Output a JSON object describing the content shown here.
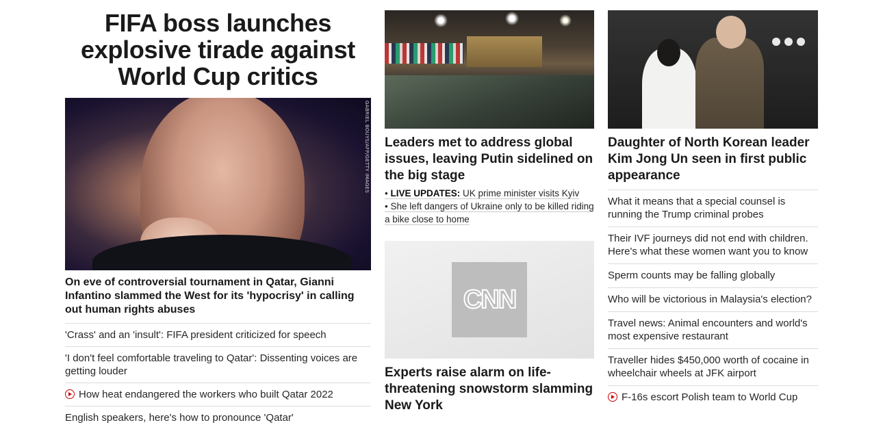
{
  "left": {
    "headline": "FIFA boss launches explosive tirade against World Cup critics",
    "image_credit": "GABRIEL BOUYS/AFP/GETTY IMAGES",
    "lead": "On eve of controversial tournament in Qatar, Gianni Infantino slammed the West for its 'hypocrisy' in calling out human rights abuses",
    "links": [
      {
        "text": "'Crass' and an 'insult': FIFA president criticized for speech",
        "video": false
      },
      {
        "text": "'I don't feel comfortable traveling to Qatar': Dissenting voices are getting louder",
        "video": false
      },
      {
        "text": "How heat endangered the workers who built Qatar 2022",
        "video": true
      },
      {
        "text": "English speakers, here's how to pronounce 'Qatar'",
        "video": false
      }
    ]
  },
  "middle": {
    "story1": {
      "headline": "Leaders met to address global issues, leaving Putin sidelined on the big stage",
      "live_label": "LIVE UPDATES:",
      "live_text": "UK prime minister visits Kyiv",
      "link2": "She left dangers of Ukraine only to be killed riding a bike close to home"
    },
    "story2": {
      "logo_text": "CNN",
      "headline": "Experts raise alarm on life-threatening snowstorm slamming New York"
    }
  },
  "right": {
    "headline": "Daughter of North Korean leader Kim Jong Un seen in first public appearance",
    "links": [
      {
        "text": "What it means that a special counsel is running the Trump criminal probes",
        "video": false
      },
      {
        "text": "Their IVF journeys did not end with children. Here's what these women want you to know",
        "video": false
      },
      {
        "text": "Sperm counts may be falling globally",
        "video": false
      },
      {
        "text": "Who will be victorious in Malaysia's election?",
        "video": false
      },
      {
        "text": "Travel news: Animal encounters and world's most expensive restaurant",
        "video": false
      },
      {
        "text": "Traveller hides $450,000 worth of cocaine in wheelchair wheels at JFK airport",
        "video": false
      },
      {
        "text": "F-16s escort Polish team to World Cup",
        "video": true
      }
    ]
  },
  "colors": {
    "video_icon": "#cc0000",
    "divider": "#dcdcdc",
    "text": "#262626"
  }
}
